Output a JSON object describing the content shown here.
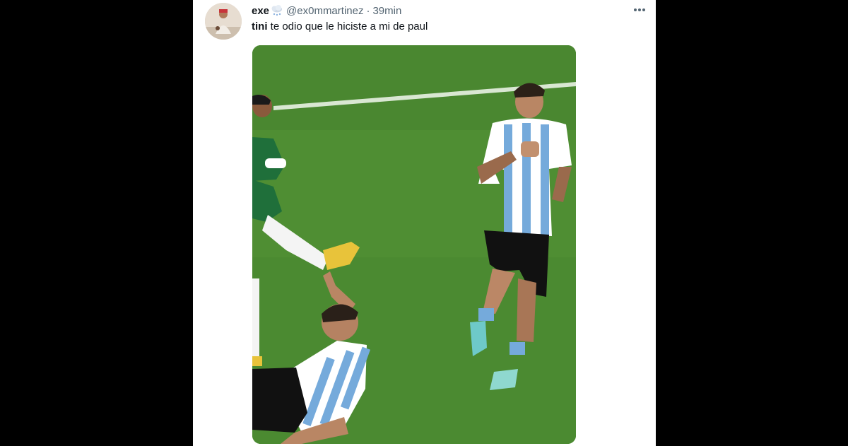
{
  "tweet": {
    "display_name": "exe",
    "name_emoji": "cloud-snow-emoji",
    "handle": "@ex0mmartinez",
    "separator": "·",
    "timestamp": "39min",
    "text_tag": "tini",
    "text_body": " te odio que le hiciste a mi de paul",
    "more_icon": "more-horizontal-icon",
    "media": {
      "description_icon": "photo",
      "colors": {
        "pitch": "#4f8e33",
        "pitch_dark": "#447f2c",
        "sky_blue": "#75aadb",
        "kit_white": "#ffffff",
        "shorts": "#111111",
        "saudi_green": "#1f6f3a",
        "boot_yellow": "#e8c33a"
      }
    }
  },
  "page": {
    "background": "#000000",
    "card_background": "#ffffff"
  }
}
